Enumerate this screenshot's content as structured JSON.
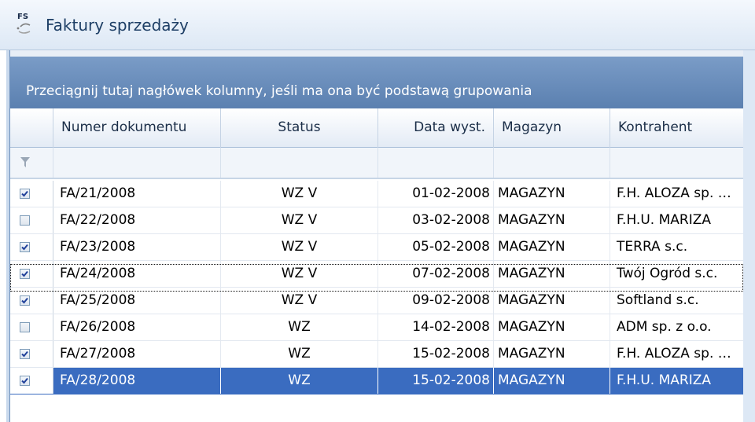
{
  "window": {
    "title": "Faktury sprzedaży",
    "icon_label": "FS",
    "icon": "sales-invoice-icon"
  },
  "grid": {
    "group_hint": "Przeciągnij tutaj nagłówek kolumny, jeśli ma ona być podstawą grupowania",
    "columns": [
      {
        "key": "num",
        "label": "Numer dokumentu"
      },
      {
        "key": "status",
        "label": "Status"
      },
      {
        "key": "date",
        "label": "Data wyst."
      },
      {
        "key": "mag",
        "label": "Magazyn"
      },
      {
        "key": "kon",
        "label": "Kontrahent"
      }
    ],
    "filter_icon": "funnel-icon",
    "rows": [
      {
        "checked": true,
        "num": "FA/21/2008",
        "status": "WZ V",
        "date": "01-02-2008",
        "mag": "MAGAZYN",
        "kon": "F.H. ALOZA sp. …"
      },
      {
        "checked": false,
        "num": "FA/22/2008",
        "status": "WZ V",
        "date": "03-02-2008",
        "mag": "MAGAZYN",
        "kon": "F.H.U. MARIZA"
      },
      {
        "checked": true,
        "num": "FA/23/2008",
        "status": "WZ V",
        "date": "05-02-2008",
        "mag": "MAGAZYN",
        "kon": "TERRA s.c."
      },
      {
        "checked": true,
        "num": "FA/24/2008",
        "status": "WZ V",
        "date": "07-02-2008",
        "mag": "MAGAZYN",
        "kon": "Twój Ogród s.c."
      },
      {
        "checked": true,
        "num": "FA/25/2008",
        "status": "WZ V",
        "date": "09-02-2008",
        "mag": "MAGAZYN",
        "kon": "Softland s.c."
      },
      {
        "checked": false,
        "num": "FA/26/2008",
        "status": "WZ",
        "date": "14-02-2008",
        "mag": "MAGAZYN",
        "kon": "ADM sp. z o.o."
      },
      {
        "checked": true,
        "num": "FA/27/2008",
        "status": "WZ",
        "date": "15-02-2008",
        "mag": "MAGAZYN",
        "kon": "F.H. ALOZA sp. …"
      },
      {
        "checked": true,
        "num": "FA/28/2008",
        "status": "WZ",
        "date": "15-02-2008",
        "mag": "MAGAZYN",
        "kon": "F.H.U. MARIZA"
      }
    ],
    "selected_index": 7
  },
  "colors": {
    "group_panel": "#5b80b0",
    "selection": "#3a6cc0",
    "title_text": "#1e3f66"
  }
}
